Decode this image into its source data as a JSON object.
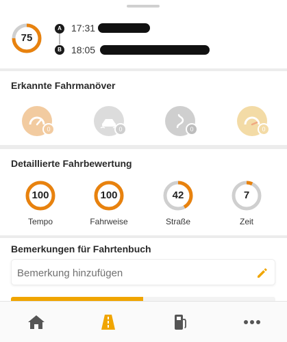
{
  "trip": {
    "score": "75",
    "score_fraction": 0.75,
    "start": {
      "marker": "A",
      "time": "17:31"
    },
    "end": {
      "marker": "B",
      "time": "18:05"
    }
  },
  "maneuvers": {
    "title": "Erkannte Fahrmanöver",
    "items": [
      {
        "icon": "speedometer-icon",
        "count": "0",
        "color": "#f2cba0"
      },
      {
        "icon": "car-skid-icon",
        "count": "0",
        "color": "#dcdcdc"
      },
      {
        "icon": "curve-road-icon",
        "count": "0",
        "color": "#cfcfcf"
      },
      {
        "icon": "gauge-icon",
        "count": "0",
        "color": "#f3dba6"
      }
    ]
  },
  "ratings": {
    "title": "Detaillierte Fahrbewertung",
    "items": [
      {
        "label": "Tempo",
        "value": "100",
        "fraction": 1.0
      },
      {
        "label": "Fahrweise",
        "value": "100",
        "fraction": 1.0
      },
      {
        "label": "Straße",
        "value": "42",
        "fraction": 0.42
      },
      {
        "label": "Zeit",
        "value": "7",
        "fraction": 0.07
      }
    ]
  },
  "remarks": {
    "title": "Bemerkungen für Fahrtenbuch",
    "placeholder": "Bemerkung hinzufügen",
    "progress_fraction": 0.5
  },
  "colors": {
    "accent": "#f0a500",
    "ring_orange": "#e8820e",
    "ring_grey": "#cfcfcf",
    "nav_inactive": "#555555"
  },
  "nav": [
    {
      "icon": "home-icon",
      "active": false
    },
    {
      "icon": "road-icon",
      "active": true
    },
    {
      "icon": "fuel-pump-icon",
      "active": false
    },
    {
      "icon": "more-dots-icon",
      "active": false
    }
  ]
}
